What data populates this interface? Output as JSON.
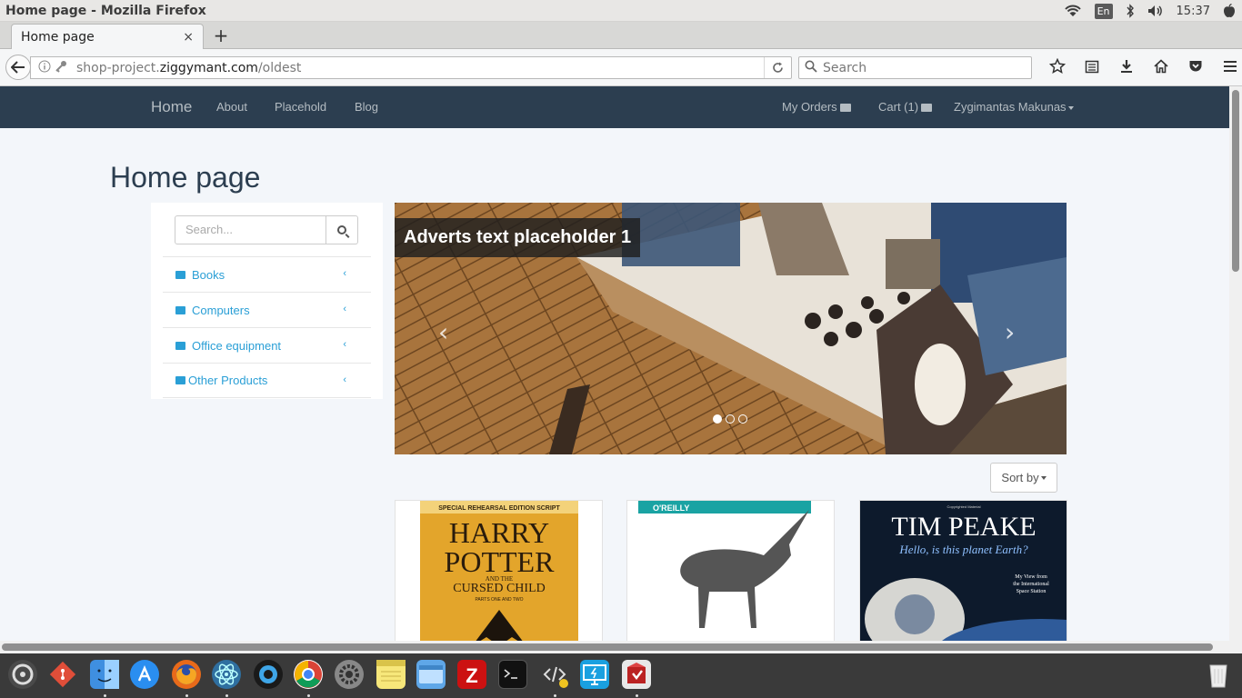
{
  "os": {
    "window_title": "Home page - Mozilla Firefox",
    "lang": "En",
    "time": "15:37"
  },
  "browser": {
    "tab_title": "Home page",
    "tab_close": "×",
    "new_tab": "+",
    "url_prefix": "shop-project.",
    "url_host": "ziggymant.com",
    "url_path": "/oldest",
    "search_placeholder": "Search"
  },
  "site": {
    "brand": "Home",
    "nav": [
      "About",
      "Placehold",
      "Blog"
    ],
    "my_orders": "My Orders",
    "cart": "Cart (1)",
    "user": "Zygimantas Makunas",
    "heading": "Home page"
  },
  "sidebar": {
    "search_placeholder": "Search...",
    "categories": [
      "Books",
      "Computers",
      "Office equipment",
      "Other Products"
    ]
  },
  "carousel": {
    "caption": "Adverts text placeholder 1",
    "slide_count": 3,
    "active_slide": 1
  },
  "sort": {
    "label": "Sort by"
  },
  "products": [
    {
      "lines": [
        "SPECIAL REHEARSAL EDITION SCRIPT",
        "HARRY",
        "POTTER",
        "AND THE",
        "CURSED CHILD",
        "PARTS ONE AND TWO"
      ]
    },
    {
      "lines": [
        "O'REILLY"
      ]
    },
    {
      "lines": [
        "Copyrighted Material",
        "TIM PEAKE",
        "Hello, is this planet Earth?",
        "My View from",
        "the International",
        "Space Station"
      ]
    }
  ],
  "colors": {
    "site_nav_bg": "#2c3e50",
    "link": "#2a9fd6",
    "page_bg": "#f3f6fa"
  }
}
